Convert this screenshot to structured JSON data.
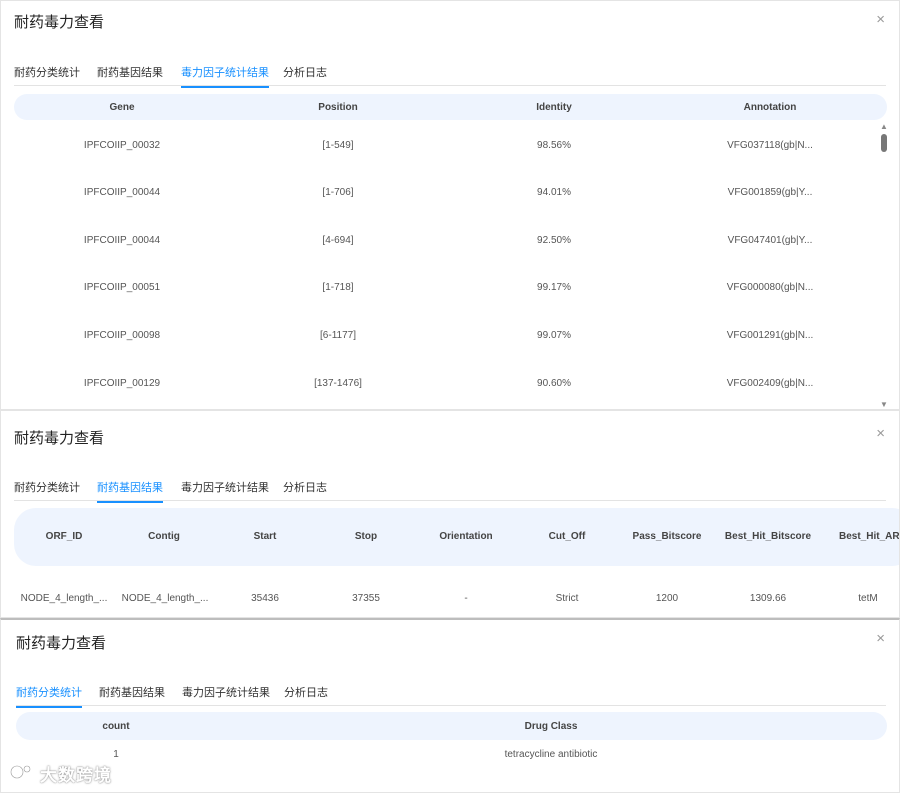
{
  "panel1": {
    "title": "耐药毒力查看",
    "close": "×",
    "tabs": [
      "耐药分类统计",
      "耐药基因结果",
      "毒力因子统计结果",
      "分析日志"
    ],
    "columns": [
      "Gene",
      "Position",
      "Identity",
      "Annotation"
    ],
    "rows": [
      [
        "IPFCOIIP_00032",
        "[1-549]",
        "98.56%",
        "VFG037118(gb|N..."
      ],
      [
        "IPFCOIIP_00044",
        "[1-706]",
        "94.01%",
        "VFG001859(gb|Y..."
      ],
      [
        "IPFCOIIP_00044",
        "[4-694]",
        "92.50%",
        "VFG047401(gb|Y..."
      ],
      [
        "IPFCOIIP_00051",
        "[1-718]",
        "99.17%",
        "VFG000080(gb|N..."
      ],
      [
        "IPFCOIIP_00098",
        "[6-1177]",
        "99.07%",
        "VFG001291(gb|N..."
      ],
      [
        "IPFCOIIP_00129",
        "[137-1476]",
        "90.60%",
        "VFG002409(gb|N..."
      ]
    ],
    "scroll_up": "▲",
    "scroll_down": "▼"
  },
  "panel2": {
    "title": "耐药毒力查看",
    "close": "×",
    "tabs": [
      "耐药分类统计",
      "耐药基因结果",
      "毒力因子统计结果",
      "分析日志"
    ],
    "columns": [
      "ORF_ID",
      "Contig",
      "Start",
      "Stop",
      "Orientation",
      "Cut_Off",
      "Pass_Bitscore",
      "Best_Hit_Bitscore",
      "Best_Hit_AR"
    ],
    "rows": [
      [
        "NODE_4_length_...",
        "NODE_4_length_...",
        "35436",
        "37355",
        "-",
        "Strict",
        "1200",
        "1309.66",
        "tetM"
      ]
    ]
  },
  "panel3": {
    "title": "耐药毒力查看",
    "close": "×",
    "tabs": [
      "耐药分类统计",
      "耐药基因结果",
      "毒力因子统计结果",
      "分析日志"
    ],
    "columns": [
      "count",
      "Drug Class"
    ],
    "rows": [
      [
        "1",
        "tetracycline antibiotic"
      ]
    ]
  },
  "watermark": {
    "icon": "watermark-logo-icon",
    "text": "大数跨境"
  },
  "colors": {
    "accent": "#1890ff",
    "header_bg": "#eef4fe"
  }
}
